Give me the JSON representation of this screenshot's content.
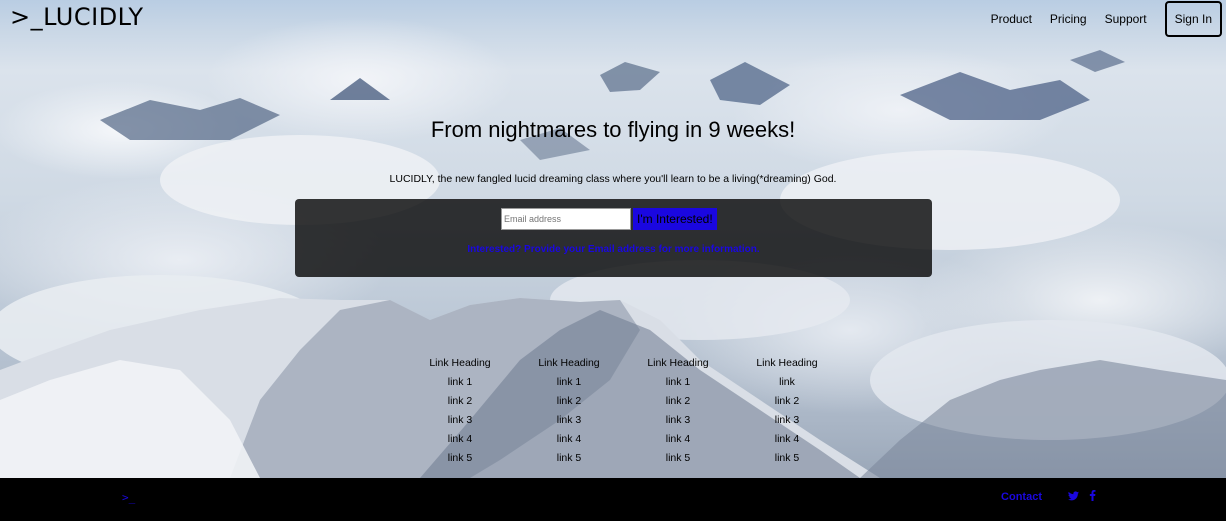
{
  "nav": {
    "logo": ">_LUCIDLY",
    "links": [
      "Product",
      "Pricing",
      "Support"
    ],
    "signin": "Sign In"
  },
  "hero": {
    "title": "From nightmares to flying in 9 weeks!",
    "subtitle": "LUCIDLY, the new fangled lucid dreaming class where you'll learn to be a living(*dreaming) God.",
    "email_placeholder": "Email address",
    "button": "I'm Interested!",
    "note": "Interested? Provide your Email address for more information."
  },
  "link_columns": [
    {
      "heading": "Link Heading",
      "links": [
        "link 1",
        "link 2",
        "link 3",
        "link 4",
        "link 5"
      ]
    },
    {
      "heading": "Link Heading",
      "links": [
        "link 1",
        "link 2",
        "link 3",
        "link 4",
        "link 5"
      ]
    },
    {
      "heading": "Link Heading",
      "links": [
        "link 1",
        "link 2",
        "link 3",
        "link 4",
        "link 5"
      ]
    },
    {
      "heading": "Link Heading",
      "links": [
        "link",
        "link 2",
        "link 3",
        "link 4",
        "link 5"
      ]
    }
  ],
  "footer": {
    "logo": ">_",
    "contact": "Contact",
    "twitter_icon": "twitter-icon",
    "facebook_icon": "facebook-icon"
  },
  "colors": {
    "accent": "#1a07e0",
    "footer_bg": "#000000"
  }
}
